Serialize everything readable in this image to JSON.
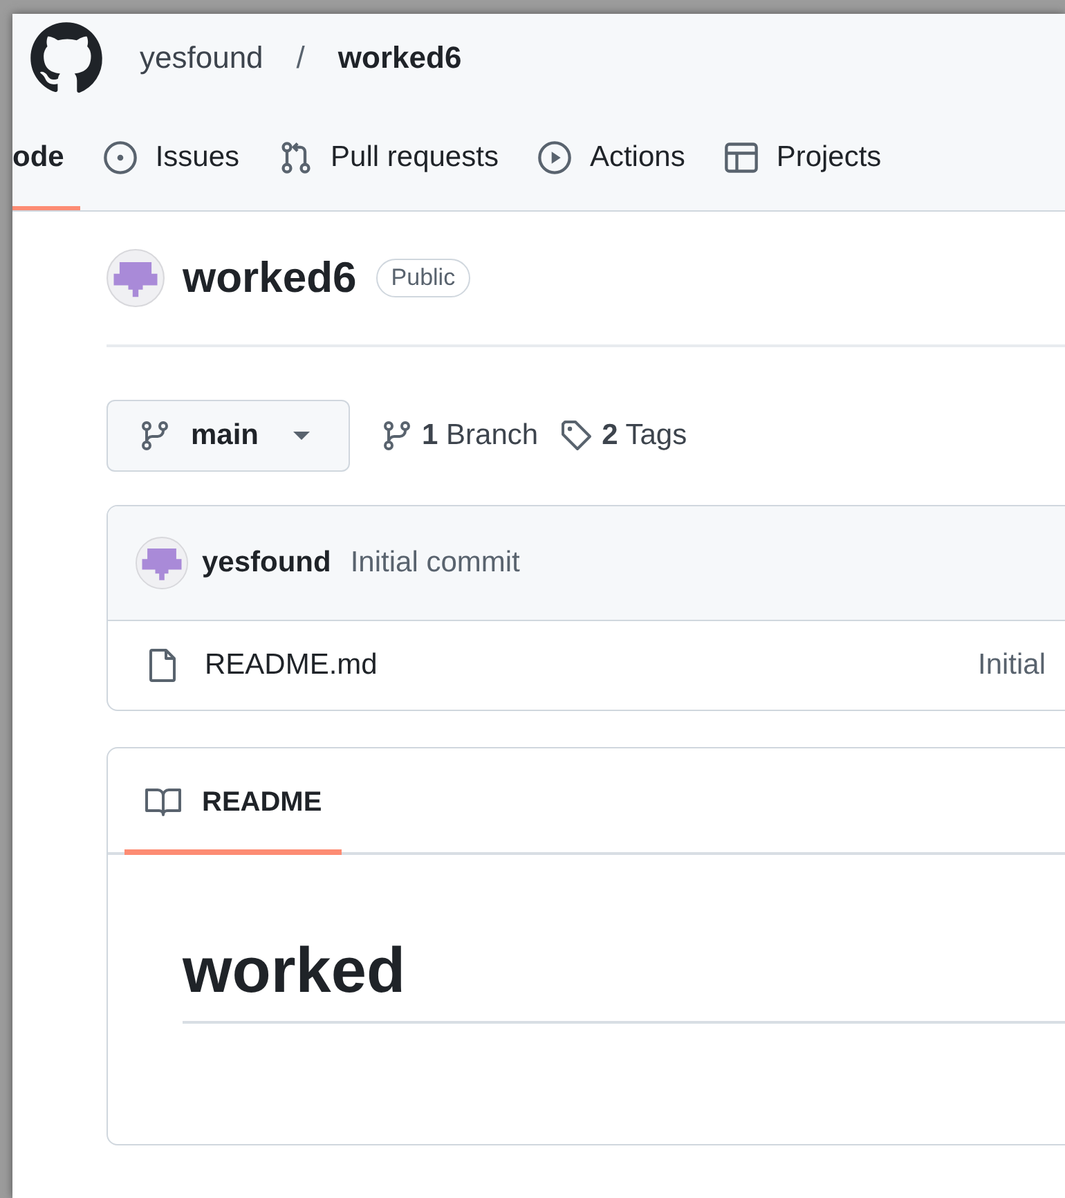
{
  "header": {
    "owner": "yesfound",
    "separator": "/",
    "repo": "worked6"
  },
  "tabs": [
    {
      "label": "ode",
      "selected": true
    },
    {
      "label": "Issues",
      "kind": "issue",
      "selected": false
    },
    {
      "label": "Pull requests",
      "kind": "pull",
      "selected": false
    },
    {
      "label": "Actions",
      "kind": "play",
      "selected": false
    },
    {
      "label": "Projects",
      "kind": "table",
      "selected": false
    }
  ],
  "repo": {
    "name": "worked6",
    "visibility": "Public"
  },
  "branch_button": {
    "label": "main"
  },
  "stats": [
    {
      "kind": "branch",
      "text": "**1** Branch"
    },
    {
      "kind": "tag",
      "text": "**2** Tags"
    }
  ],
  "commit": {
    "author": "yesfound",
    "message": "Initial commit"
  },
  "files": [
    {
      "name": "README.md",
      "commit_message": "Initial"
    }
  ],
  "readme": {
    "tab": {
      "label": "README",
      "selected": true
    },
    "heading": "worked"
  }
}
